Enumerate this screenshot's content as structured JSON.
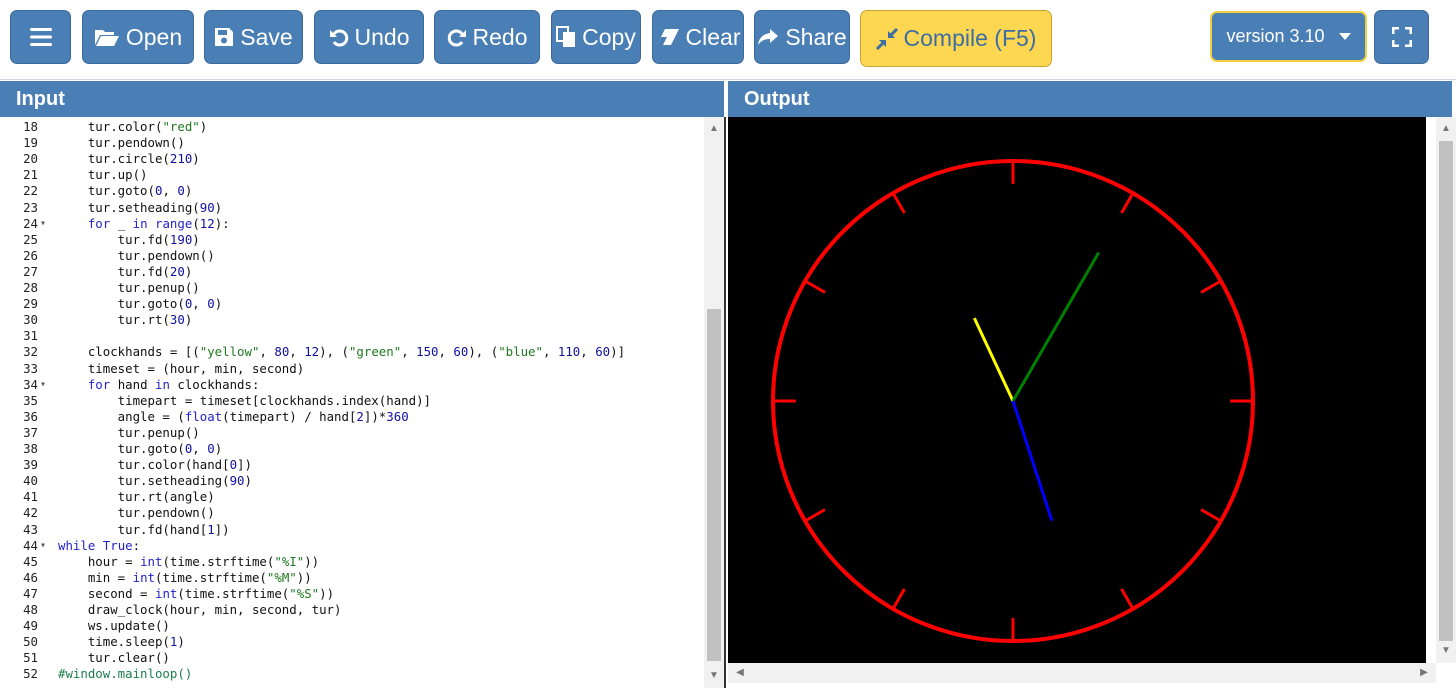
{
  "toolbar": {
    "menu_label": "",
    "open_label": "Open",
    "save_label": "Save",
    "undo_label": "Undo",
    "redo_label": "Redo",
    "copy_label": "Copy",
    "clear_label": "Clear",
    "share_label": "Share",
    "compile_label": "Compile (F5)",
    "version_label": "version 3.10",
    "icons": [
      "menu-icon",
      "folder-open-icon",
      "floppy-disk-icon",
      "undo-icon",
      "redo-icon",
      "copy-icon",
      "eraser-icon",
      "share-icon",
      "compress-icon",
      "caret-down-icon",
      "fullscreen-icon"
    ],
    "colors": {
      "button_blue": "#4a7fb5",
      "compile_yellow": "#fdd652",
      "compile_text": "#3c6ea3"
    }
  },
  "panels": {
    "input_title": "Input",
    "output_title": "Output"
  },
  "editor": {
    "lines": [
      {
        "n": "18",
        "fold": "",
        "text": "    tur.color(\"red\")"
      },
      {
        "n": "19",
        "fold": "",
        "text": "    tur.pendown()"
      },
      {
        "n": "20",
        "fold": "",
        "text": "    tur.circle(210)"
      },
      {
        "n": "21",
        "fold": "",
        "text": "    tur.up()"
      },
      {
        "n": "22",
        "fold": "",
        "text": "    tur.goto(0, 0)"
      },
      {
        "n": "23",
        "fold": "",
        "text": "    tur.setheading(90)"
      },
      {
        "n": "24",
        "fold": "▾",
        "text": "    for _ in range(12):"
      },
      {
        "n": "25",
        "fold": "",
        "text": "        tur.fd(190)"
      },
      {
        "n": "26",
        "fold": "",
        "text": "        tur.pendown()"
      },
      {
        "n": "27",
        "fold": "",
        "text": "        tur.fd(20)"
      },
      {
        "n": "28",
        "fold": "",
        "text": "        tur.penup()"
      },
      {
        "n": "29",
        "fold": "",
        "text": "        tur.goto(0, 0)"
      },
      {
        "n": "30",
        "fold": "",
        "text": "        tur.rt(30)"
      },
      {
        "n": "31",
        "fold": "",
        "text": ""
      },
      {
        "n": "32",
        "fold": "",
        "text": "    clockhands = [(\"yellow\", 80, 12), (\"green\", 150, 60), (\"blue\", 110, 60)]"
      },
      {
        "n": "33",
        "fold": "",
        "text": "    timeset = (hour, min, second)"
      },
      {
        "n": "34",
        "fold": "▾",
        "text": "    for hand in clockhands:"
      },
      {
        "n": "35",
        "fold": "",
        "text": "        timepart = timeset[clockhands.index(hand)]"
      },
      {
        "n": "36",
        "fold": "",
        "text": "        angle = (float(timepart) / hand[2])*360"
      },
      {
        "n": "37",
        "fold": "",
        "text": "        tur.penup()"
      },
      {
        "n": "38",
        "fold": "",
        "text": "        tur.goto(0, 0)"
      },
      {
        "n": "39",
        "fold": "",
        "text": "        tur.color(hand[0])"
      },
      {
        "n": "40",
        "fold": "",
        "text": "        tur.setheading(90)"
      },
      {
        "n": "41",
        "fold": "",
        "text": "        tur.rt(angle)"
      },
      {
        "n": "42",
        "fold": "",
        "text": "        tur.pendown()"
      },
      {
        "n": "43",
        "fold": "",
        "text": "        tur.fd(hand[1])"
      },
      {
        "n": "44",
        "fold": "▾",
        "text": "while True:"
      },
      {
        "n": "45",
        "fold": "",
        "text": "    hour = int(time.strftime(\"%I\"))"
      },
      {
        "n": "46",
        "fold": "",
        "text": "    min = int(time.strftime(\"%M\"))"
      },
      {
        "n": "47",
        "fold": "",
        "text": "    second = int(time.strftime(\"%S\"))"
      },
      {
        "n": "48",
        "fold": "",
        "text": "    draw_clock(hour, min, second, tur)"
      },
      {
        "n": "49",
        "fold": "",
        "text": "    ws.update()"
      },
      {
        "n": "50",
        "fold": "",
        "text": "    time.sleep(1)"
      },
      {
        "n": "51",
        "fold": "",
        "text": "    tur.clear()"
      },
      {
        "n": "52",
        "fold": "",
        "text": "#window.mainloop()"
      }
    ]
  },
  "output": {
    "background": "#000000",
    "face_color": "#ff0000",
    "tick_count": 12,
    "hands": [
      {
        "color": "#ffff00",
        "length": 80,
        "angle_deg": -25
      },
      {
        "color": "#008000",
        "length": 150,
        "angle_deg": 30
      },
      {
        "color": "#0000ff",
        "length": 110,
        "angle_deg": 162
      }
    ]
  }
}
